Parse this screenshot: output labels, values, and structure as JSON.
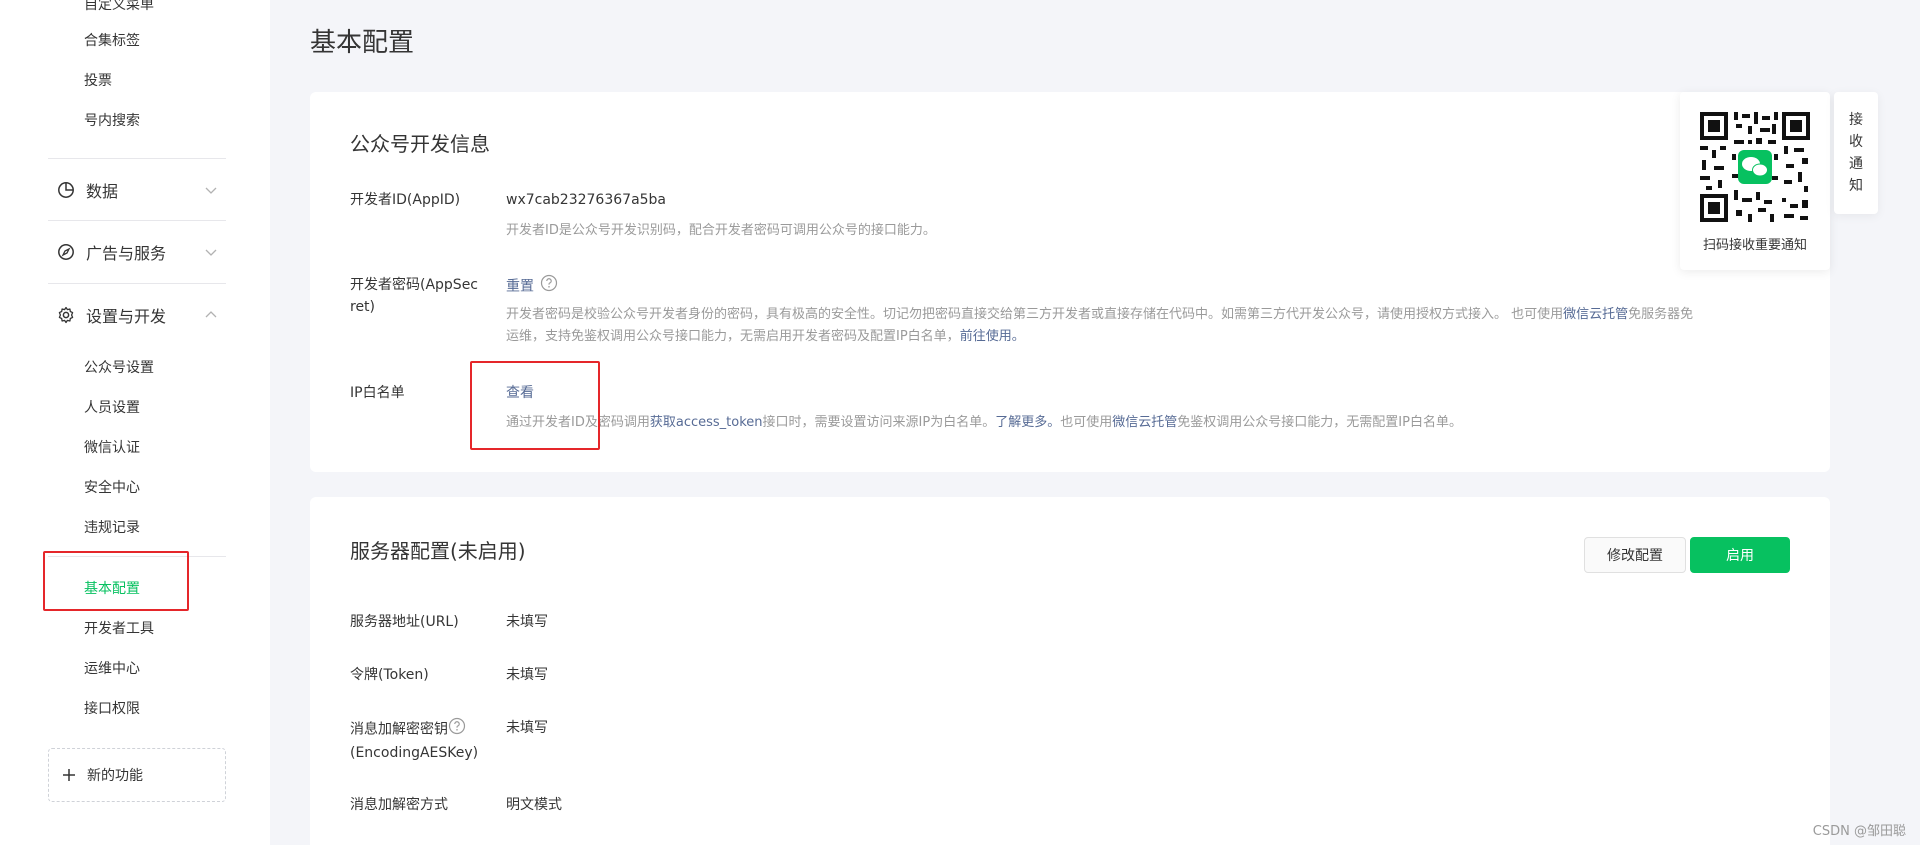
{
  "sidebar": {
    "top_items": [
      {
        "label": "自定义菜单"
      },
      {
        "label": "合集标签"
      },
      {
        "label": "投票"
      },
      {
        "label": "号内搜索"
      }
    ],
    "groups": [
      {
        "label": "数据",
        "icon": "pie-chart-icon",
        "expanded": false
      },
      {
        "label": "广告与服务",
        "icon": "compass-icon",
        "expanded": false
      },
      {
        "label": "设置与开发",
        "icon": "gear-icon",
        "expanded": true
      }
    ],
    "settings_items": [
      {
        "label": "公众号设置"
      },
      {
        "label": "人员设置"
      },
      {
        "label": "微信认证"
      },
      {
        "label": "安全中心"
      },
      {
        "label": "违规记录"
      }
    ],
    "dev_items": [
      {
        "label": "基本配置",
        "active": true
      },
      {
        "label": "开发者工具"
      },
      {
        "label": "运维中心"
      },
      {
        "label": "接口权限"
      }
    ],
    "new_feature": "新的功能"
  },
  "page": {
    "title": "基本配置"
  },
  "dev_info": {
    "title": "公众号开发信息",
    "appid_label": "开发者ID(AppID)",
    "appid_value": "wx7cab23276367a5ba",
    "appid_desc": "开发者ID是公众号开发识别码，配合开发者密码可调用公众号的接口能力。",
    "secret_label_1": "开发者密码(AppSec",
    "secret_label_2": "ret)",
    "secret_reset": "重置",
    "secret_desc_1": "开发者密码是校验公众号开发者身份的密码，具有极高的安全性。切记勿把密码直接交给第三方开发者或直接存储在代码中。如需第三方代开发公众号，请使用授权方式接入。 也可使用",
    "secret_desc_link1": "微信云托管",
    "secret_desc_2": "免服务器免",
    "secret_desc_3": "运维，支持免鉴权调用公众号接口能力，无需启用开发者密码及配置IP白名单，",
    "secret_desc_link2": "前往使用。",
    "ip_label": "IP白名单",
    "ip_view": "查看",
    "ip_desc_1": "通过开发者ID及密码调用",
    "ip_desc_link1": "获取access_token",
    "ip_desc_2": "接口时，需要设置访问来源IP为白名单。",
    "ip_desc_link2": "了解更多。",
    "ip_desc_3": "也可使用",
    "ip_desc_link3": "微信云托管",
    "ip_desc_4": "免鉴权调用公众号接口能力，无需配置IP白名单。"
  },
  "server_config": {
    "title": "服务器配置(未启用)",
    "modify_button": "修改配置",
    "enable_button": "启用",
    "url_label": "服务器地址(URL)",
    "url_value": "未填写",
    "token_label": "令牌(Token)",
    "token_value": "未填写",
    "aes_label_1": "消息加解密密钥",
    "aes_label_2": "(EncodingAESKey)",
    "aes_value": "未填写",
    "mode_label": "消息加解密方式",
    "mode_value": "明文模式"
  },
  "qr_widget": {
    "caption": "扫码接收重要通知"
  },
  "notify_tab": [
    "接",
    "收",
    "通",
    "知"
  ],
  "watermark": "CSDN @邹田聪",
  "colors": {
    "accent": "#07c160",
    "link": "#576b95",
    "highlight": "#e5262a"
  }
}
